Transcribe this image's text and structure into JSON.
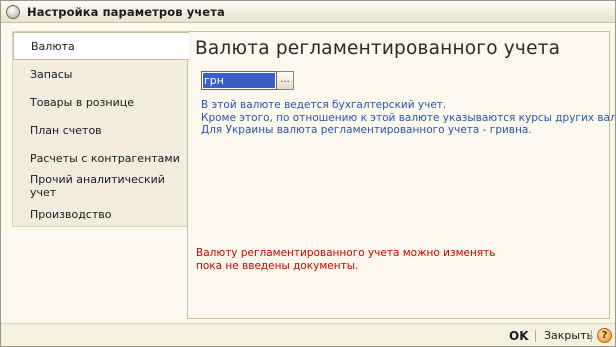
{
  "window": {
    "title": "Настройка параметров учета",
    "app_icon": "1c-logo-icon",
    "app_icon_glyph": "1C"
  },
  "nav": {
    "items": [
      {
        "label": "Валюта",
        "active": true
      },
      {
        "label": "Запасы",
        "active": false
      },
      {
        "label": "Товары в рознице",
        "active": false
      },
      {
        "label": "План счетов",
        "active": false
      },
      {
        "label": "Расчеты с контрагентами",
        "active": false
      },
      {
        "label": "Прочий аналитический учет",
        "active": false
      },
      {
        "label": "Производство",
        "active": false
      }
    ]
  },
  "panel": {
    "title": "Валюта регламентированного учета",
    "currency_field": {
      "value": "грн",
      "select_button": "..."
    },
    "info_lines": [
      "В этой валюте ведется бухгалтерский учет.",
      "Кроме этого, по отношению к этой валюте указываются курсы других валют.",
      "Для Украины валюта регламентированного учета - гривна."
    ],
    "warning_lines": [
      "Валюту регламентированного учета можно изменять",
      "пока не введены документы."
    ]
  },
  "footer": {
    "ok_label": "OK",
    "close_label": "Закрыть",
    "help_label": "?"
  },
  "colors": {
    "info_text": "#2f52a4",
    "warning_text": "#cc0000",
    "selection": "#3a5fc8",
    "window_bg": "#fbf8ee",
    "nav_bg": "#f1ecdd"
  }
}
